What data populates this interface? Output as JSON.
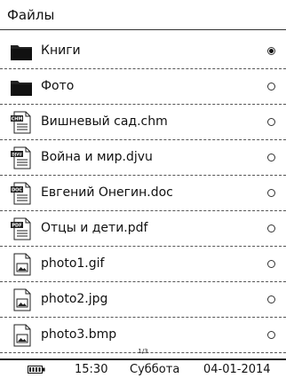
{
  "header": {
    "title": "Файлы"
  },
  "files": [
    {
      "name": "Книги",
      "icon": "folder-icon",
      "selected": true
    },
    {
      "name": "Фото",
      "icon": "folder-icon",
      "selected": false
    },
    {
      "name": "Вишневый сад.chm",
      "icon": "chm-file-icon",
      "badge": "CHM",
      "selected": false
    },
    {
      "name": "Война и мир.djvu",
      "icon": "djvu-file-icon",
      "badge": "DJVU",
      "selected": false
    },
    {
      "name": "Евгений Онегин.doc",
      "icon": "doc-file-icon",
      "badge": "DOC",
      "selected": false
    },
    {
      "name": "Отцы и дети.pdf",
      "icon": "pdf-file-icon",
      "badge": "PDF",
      "selected": false
    },
    {
      "name": "photo1.gif",
      "icon": "image-file-icon",
      "selected": false
    },
    {
      "name": "photo2.jpg",
      "icon": "image-file-icon",
      "selected": false
    },
    {
      "name": "photo3.bmp",
      "icon": "image-file-icon",
      "selected": false
    }
  ],
  "pager": {
    "text": "1/3"
  },
  "status": {
    "battery_icon": "battery-icon",
    "time": "15:30",
    "day": "Суббота",
    "date": "04-01-2014"
  }
}
